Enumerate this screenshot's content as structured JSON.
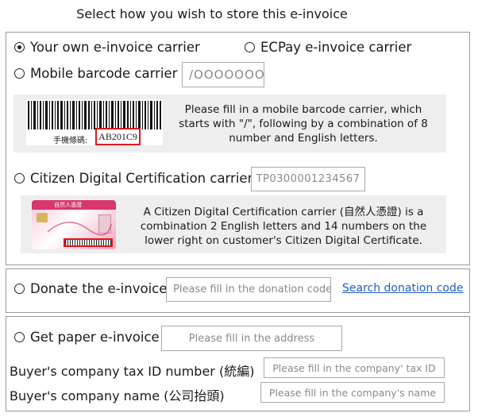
{
  "title": "Select how you wish to store this e-invoice",
  "carrier": {
    "own_label": "Your own e-invoice carrier",
    "ecpay_label": "ECPay e-invoice carrier",
    "mobile_label": "Mobile barcode carrier",
    "mobile_placeholder": "/OOOOOOO",
    "mobile_help": "Please fill in a mobile barcode carrier, which starts with \"/\", following by a combination of 8 number and English letters.",
    "barcode_caption": "手機條碼:",
    "barcode_code": "AB201C9",
    "citizen_label": "Citizen Digital Certification carrier",
    "citizen_placeholder": "TP0300001234567",
    "citizen_help": "A Citizen Digital Certification carrier (自然人憑證) is a combination 2 English letters and 14 numbers on the lower right on customer's Citizen Digital Certificate.",
    "card_title": "自然人憑證"
  },
  "donate": {
    "label": "Donate the e-invoice",
    "placeholder": "Please fill in the donation code",
    "search_link": "Search donation code"
  },
  "paper": {
    "label": "Get paper e-invoice",
    "address_placeholder": "Please fill in the address",
    "tax_id_label": "Buyer's company tax ID number (統編)",
    "tax_id_placeholder": "Please fill in the company' tax ID",
    "company_name_label": "Buyer's company name (公司抬頭)",
    "company_name_placeholder": "Please fill in the company's name"
  },
  "colors": {
    "highlight_box": "#e0161c",
    "link": "#1a5fc8",
    "panel_bg": "#eeeeee",
    "card_pink": "#d9366e"
  },
  "selected_option": "own"
}
